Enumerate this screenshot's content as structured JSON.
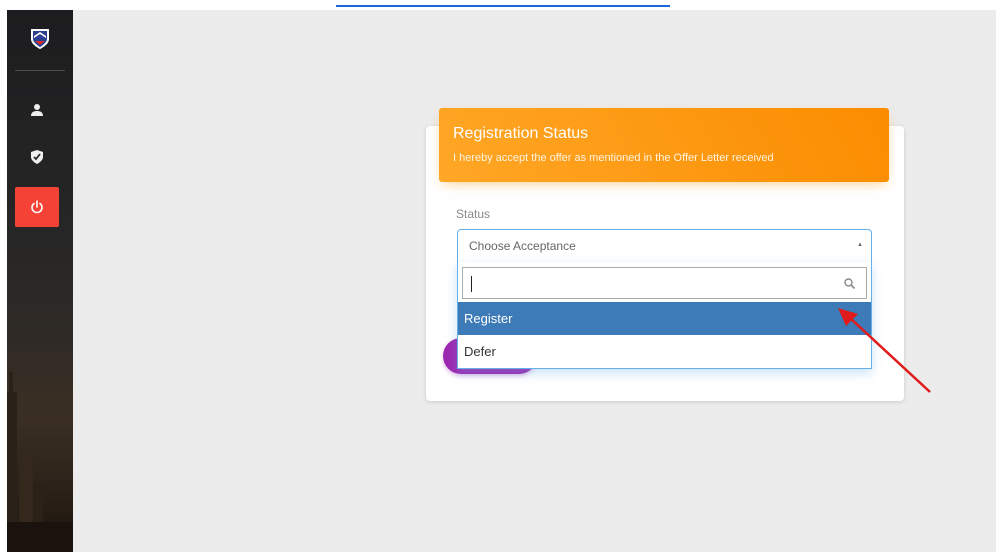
{
  "registration": {
    "title": "Registration Status",
    "subtitle": "I hereby accept the offer as mentioned in the Offer Letter received"
  },
  "status": {
    "label": "Status",
    "selected_placeholder": "Choose Acceptance",
    "search_value": "",
    "options": [
      "Register",
      "Defer"
    ],
    "highlighted_option": "Register"
  },
  "sidebar": {
    "items": [
      {
        "icon": "user-icon"
      },
      {
        "icon": "shield-check-icon"
      },
      {
        "icon": "power-icon"
      }
    ]
  },
  "colors": {
    "header_orange": "#fb8c00",
    "highlight_blue": "#3d7ab8",
    "logout_red": "#f44336",
    "button_purple": "#9c27b0",
    "annotation_red": "#e01b1b"
  }
}
